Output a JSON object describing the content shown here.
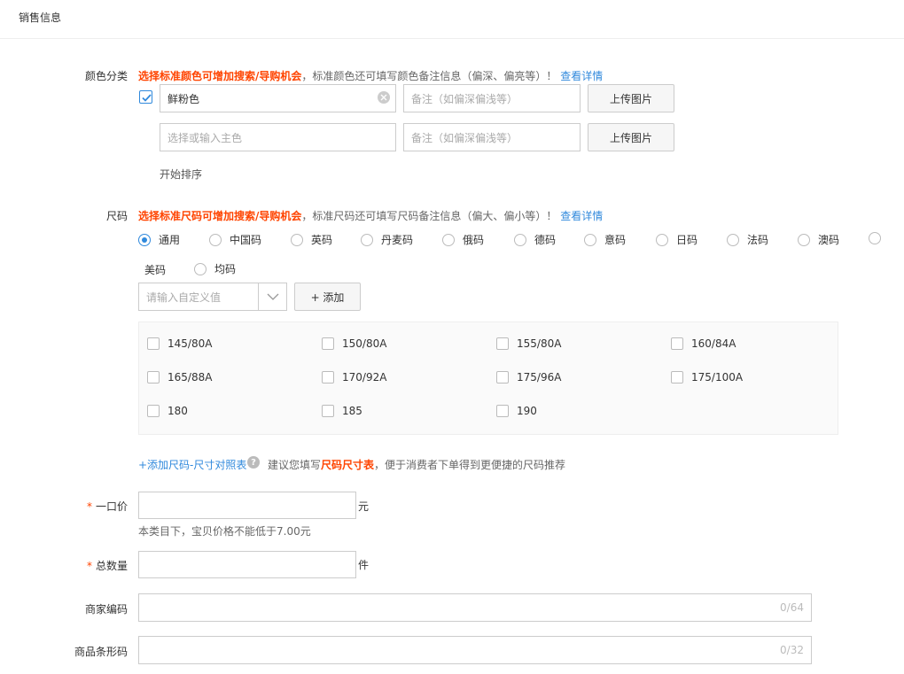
{
  "section": {
    "title": "销售信息"
  },
  "color": {
    "label": "颜色分类",
    "hint_strong": "选择标准颜色可增加搜索/导购机会",
    "hint_text": "，标准颜色还可填写颜色备注信息（偏深、偏亮等）！",
    "hint_link": "查看详情",
    "rows": [
      {
        "checked": true,
        "value": "鲜粉色",
        "note_placeholder": "备注（如偏深偏浅等）",
        "upload_label": "上传图片"
      },
      {
        "checked": false,
        "placeholder": "选择或输入主色",
        "note_placeholder": "备注（如偏深偏浅等）",
        "upload_label": "上传图片"
      }
    ],
    "sort_label": "开始排序"
  },
  "size": {
    "label": "尺码",
    "hint_strong": "选择标准尺码可增加搜索/导购机会",
    "hint_text": "，标准尺码还可填写尺码备注信息（偏大、偏小等）！",
    "hint_link": "查看详情",
    "radios": [
      "通用",
      "中国码",
      "英码",
      "丹麦码",
      "俄码",
      "德码",
      "意码",
      "日码",
      "法码",
      "澳码",
      "美码",
      "均码"
    ],
    "selected": "通用",
    "custom_placeholder": "请输入自定义值",
    "add_label": "+ 添加",
    "options": [
      "145/80A",
      "150/80A",
      "155/80A",
      "160/84A",
      "165/88A",
      "170/92A",
      "175/96A",
      "175/100A",
      "180",
      "185",
      "190"
    ],
    "chart_link": "+添加尺码-尺寸对照表",
    "chart_hint_pre": "建议您填写",
    "chart_hint_strong": "尺码尺寸表",
    "chart_hint_post": "，便于消费者下单得到更便捷的尺码推荐"
  },
  "price": {
    "required": "*",
    "label": "一口价",
    "unit": "元",
    "hint": "本类目下，宝贝价格不能低于7.00元"
  },
  "quantity": {
    "required": "*",
    "label": "总数量",
    "unit": "件"
  },
  "merchant_code": {
    "label": "商家编码",
    "counter": "0/64"
  },
  "barcode": {
    "label": "商品条形码",
    "counter": "0/32"
  }
}
